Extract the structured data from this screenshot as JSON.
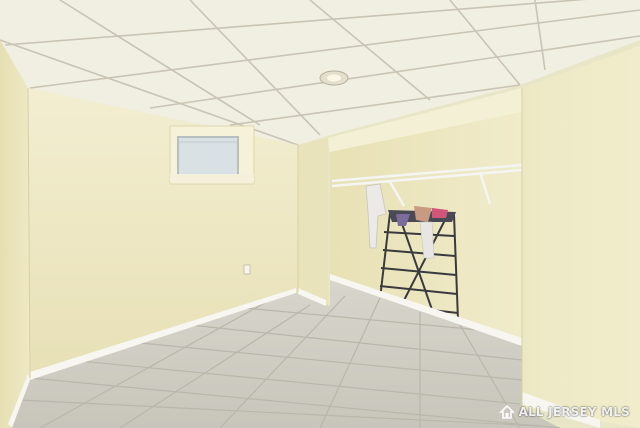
{
  "photo": {
    "scene": "basement-room",
    "colors": {
      "wall": "#efe9c2",
      "wall_shadow": "#ded7ab",
      "ceiling": "#f1eee2",
      "ceiling_grid": "#c9c4b4",
      "floor": "#d2cfc4",
      "floor_grout": "#b9b6ab",
      "baseboard": "#f7f6f1",
      "window_glass": "#d9e1e4"
    }
  },
  "watermark": {
    "text": "ALL JERSEY MLS",
    "icon": "house-logo-icon"
  }
}
